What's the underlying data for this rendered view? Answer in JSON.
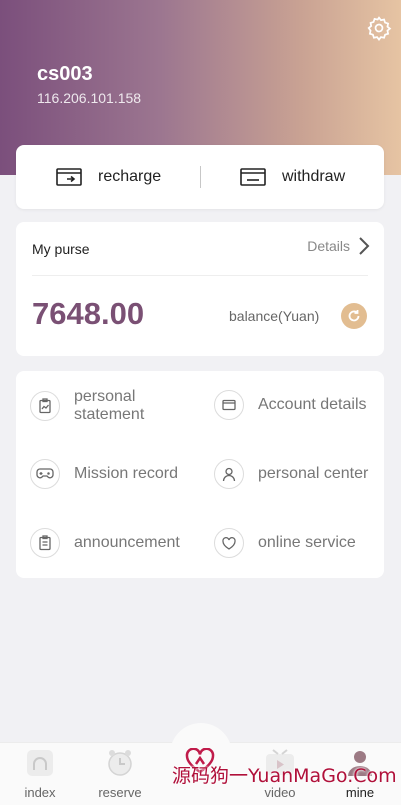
{
  "profile": {
    "username": "cs003",
    "ip": "116.206.101.158"
  },
  "actions": {
    "recharge": "recharge",
    "withdraw": "withdraw"
  },
  "purse": {
    "title": "My purse",
    "details": "Details",
    "balance": "7648.00",
    "balance_label": "balance(Yuan)"
  },
  "menu": {
    "statement_line1": "personal",
    "statement_line2": "statement",
    "account_details": "Account details",
    "mission_record": "Mission record",
    "personal_center": "personal center",
    "announcement": "announcement",
    "online_service": "online service"
  },
  "tabs": {
    "index": "index",
    "reserve": "reserve",
    "video": "video",
    "mine": "mine"
  },
  "watermark": "源码狗一YuanMaGo.Com",
  "colors": {
    "accent_purple": "#7a5074",
    "accent_gold": "#e2bd91",
    "watermark": "#b0103a"
  },
  "icons": {
    "header": "gear-icon",
    "recharge": "wallet-in-icon",
    "withdraw": "wallet-out-icon",
    "statement": "chart-clipboard-icon",
    "account": "wallet-icon",
    "mission": "gamepad-icon",
    "center": "user-icon",
    "announcement": "clipboard-icon",
    "service": "heart-chat-icon"
  }
}
